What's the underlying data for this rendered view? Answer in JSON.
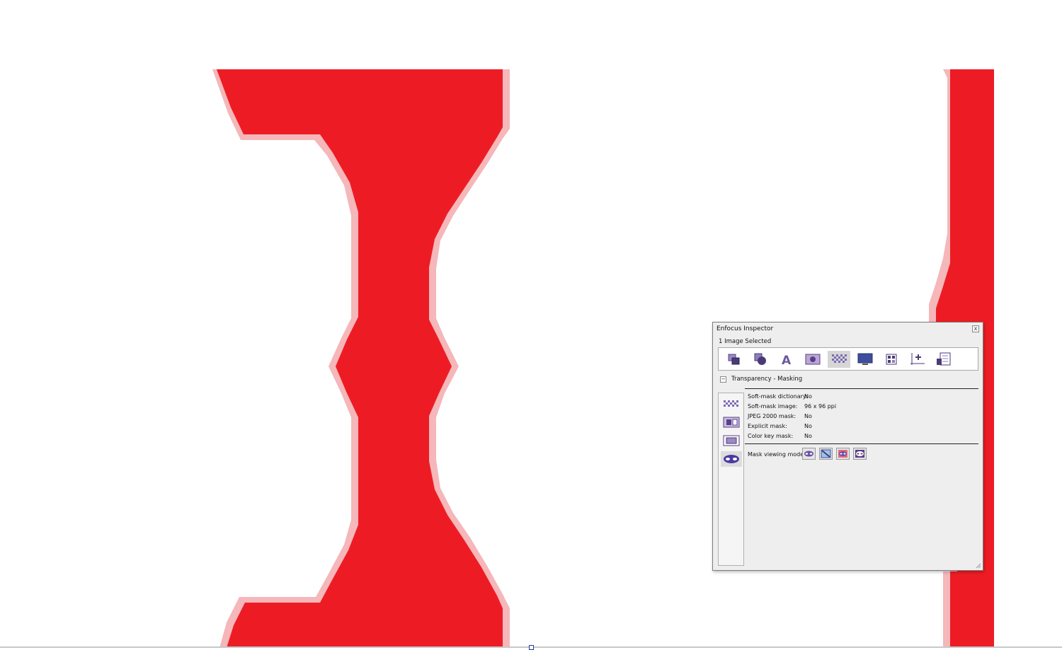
{
  "inspector": {
    "title": "Enfocus Inspector",
    "close_label": "x",
    "status": "1 Image Selected",
    "toolbar_icons": [
      "object-icon",
      "shapes-icon",
      "text-icon",
      "image-icon",
      "transparency-icon",
      "display-icon",
      "layout-icon",
      "position-icon",
      "properties-icon"
    ],
    "active_tool": "transparency-icon",
    "section": {
      "collapse_label": "−",
      "label": "Transparency - Masking"
    },
    "side_icons": [
      "softmask-icon",
      "image-mask-icon",
      "explicit-mask-icon",
      "mask-view-icon"
    ],
    "properties": [
      {
        "key": "Soft-mask dictionary:",
        "value": "No"
      },
      {
        "key": "Soft-mask image:",
        "value": "96 x 96 ppi"
      },
      {
        "key": "JPEG 2000 mask:",
        "value": "No"
      },
      {
        "key": "Explicit mask:",
        "value": "No"
      },
      {
        "key": "Color key mask:",
        "value": "No"
      }
    ],
    "mask_viewing_label": "Mask viewing mode:",
    "mask_modes": [
      "mask-mode-normal-icon",
      "mask-mode-hide-icon",
      "mask-mode-red-icon",
      "mask-mode-invert-icon"
    ]
  },
  "colors": {
    "glyph_red": "#ed1c24",
    "antialias_pink": "#f5b7b9",
    "icon_purple": "#7b4fa8",
    "window_bg": "#eeeeee"
  }
}
